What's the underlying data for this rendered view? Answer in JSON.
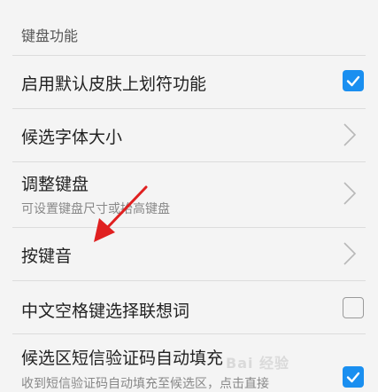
{
  "section": {
    "title": "键盘功能"
  },
  "rows": [
    {
      "title": "启用默认皮肤上划符功能",
      "control": "checkbox",
      "checked": true
    },
    {
      "title": "候选字体大小",
      "control": "chevron"
    },
    {
      "title": "调整键盘",
      "subtitle": "可设置键盘尺寸或抬高键盘",
      "control": "chevron"
    },
    {
      "title": "按键音",
      "control": "chevron"
    },
    {
      "title": "中文空格键选择联想词",
      "control": "checkbox",
      "checked": false
    },
    {
      "title": "候选区短信验证码自动填充",
      "subtitle": "收到短信验证码自动填充至候选区，点击直接",
      "control": "checkbox",
      "checked": true
    }
  ],
  "watermark": "Bai 经验",
  "colors": {
    "accent": "#1a8ff0",
    "annotation_arrow": "#e02020",
    "background": "#f4f4f4"
  }
}
